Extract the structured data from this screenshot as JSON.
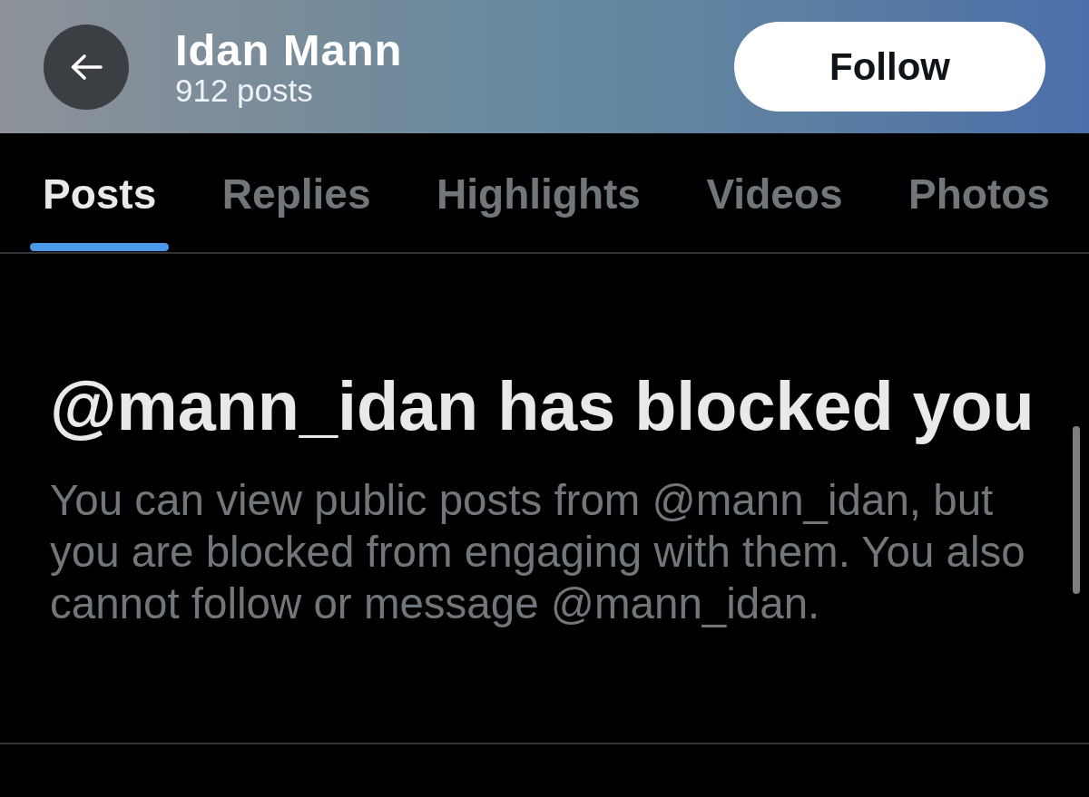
{
  "header": {
    "title": "Idan Mann",
    "subtitle": "912 posts",
    "follow_button": "Follow"
  },
  "tabs": [
    {
      "label": "Posts",
      "selected": true
    },
    {
      "label": "Replies",
      "selected": false
    },
    {
      "label": "Highlights",
      "selected": false
    },
    {
      "label": "Videos",
      "selected": false
    },
    {
      "label": "Photos",
      "selected": false
    }
  ],
  "blocked_notice": {
    "heading": "@mann_idan has blocked you",
    "message": "You can view public posts from @mann_idan, but you are blocked from engaging with them. You also cannot follow or message @mann_idan."
  }
}
